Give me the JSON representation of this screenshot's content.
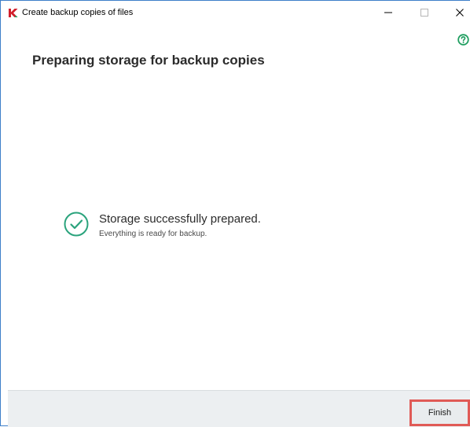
{
  "window": {
    "title": "Create backup copies of files",
    "controls": {
      "minimize_icon": "minimize-icon",
      "maximize_icon": "maximize-icon",
      "close_icon": "close-icon"
    },
    "help_icon": "help-circle-icon",
    "accent_color": "#3d7fc9"
  },
  "main": {
    "title": "Preparing storage for backup copies",
    "status": {
      "icon": "check-circle-icon",
      "icon_color": "#2aa37c",
      "title": "Storage successfully prepared.",
      "subtitle": "Everything is ready for backup."
    }
  },
  "footer": {
    "finish_label": "Finish",
    "highlight_color": "#e05a56"
  }
}
